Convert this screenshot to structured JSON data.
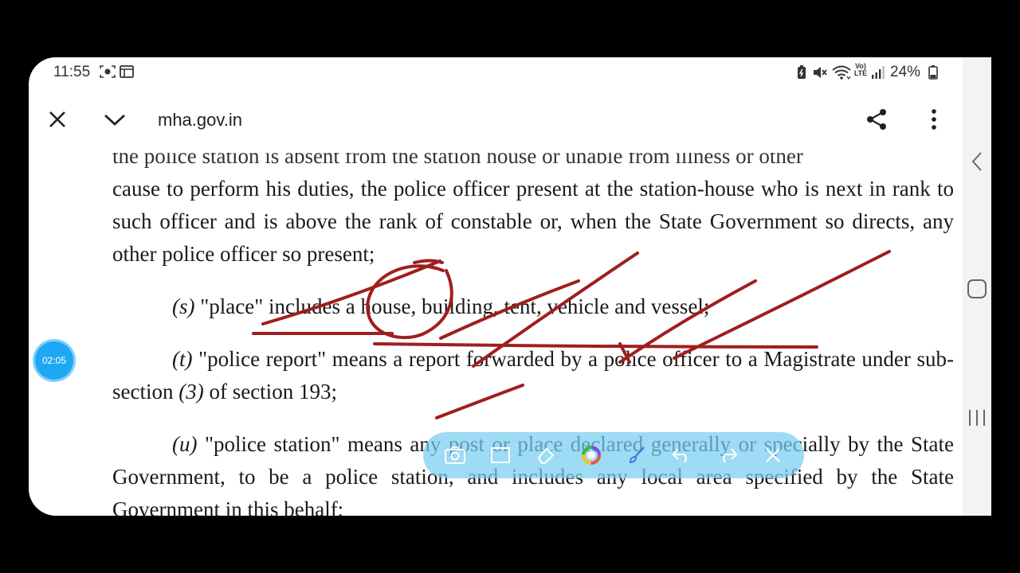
{
  "status_bar": {
    "time": "11:55",
    "battery": "24%",
    "icons": [
      "screen-record-icon",
      "gallery-icon",
      "battery-saver-icon",
      "mute-icon",
      "wifi-icon",
      "volte-icon",
      "signal-icon",
      "battery-icon"
    ],
    "volte_label": "Vo) LTE"
  },
  "toolbar": {
    "url": "mha.gov.in",
    "icons": [
      "close-icon",
      "chevron-down-icon",
      "share-icon",
      "more-vert-icon"
    ]
  },
  "document": {
    "cut_line": "the police station is absent from the station house or unable from illness or other",
    "para1": "cause to perform his duties, the police officer present at the station-house who is next in rank to such officer and is above the rank of constable or, when the State Government so directs, any other police officer so present;",
    "clause_s_label": "(s)",
    "clause_s_text": " \"place\" includes a house, building, tent, vehicle and vessel;",
    "clause_t_label": "(t)",
    "clause_t_text_a": " \"police report\" means a report forwarded by a police officer to a Magistrate under sub-section ",
    "clause_t_num": "(3)",
    "clause_t_text_b": " of section 193;",
    "clause_u_label": "(u)",
    "clause_u_text": " \"police station\" means any post or place declared generally or specially by the State Government, to be a police station, and includes any local area specified by the State Government in this behalf;"
  },
  "recording_badge": {
    "elapsed": "02:05"
  },
  "annotation_toolbar": {
    "tools": [
      "screenshot-icon",
      "rectangle-icon",
      "eraser-icon",
      "color-picker-icon",
      "brush-icon",
      "undo-icon",
      "redo-icon",
      "close-icon"
    ]
  },
  "navigation_bar": {
    "buttons": [
      "back-icon",
      "home-icon",
      "recents-icon"
    ]
  },
  "colors": {
    "ink": "#a01e1e",
    "badge": "#1ea7f4",
    "annotation_bar": "#78cdf0"
  }
}
